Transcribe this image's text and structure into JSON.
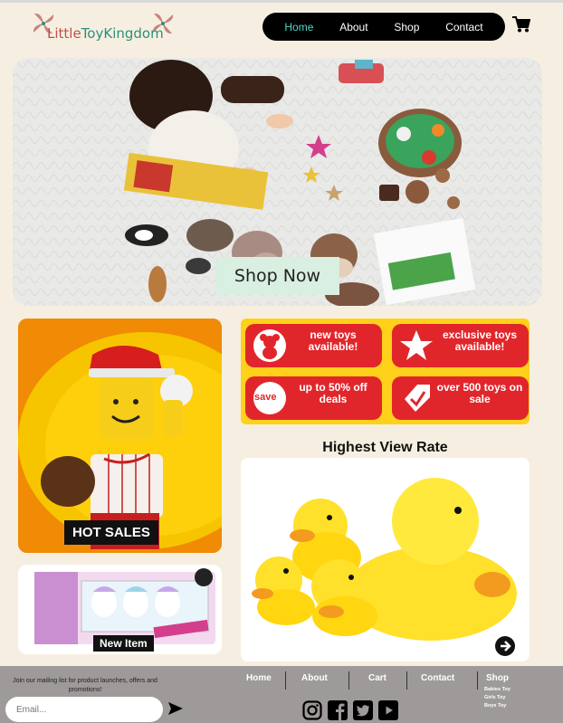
{
  "header": {
    "logo": {
      "part1": "Little",
      "part2": "Toy",
      "part3": "Kingdom"
    },
    "nav": [
      {
        "label": "Home",
        "active": true
      },
      {
        "label": "About",
        "active": false
      },
      {
        "label": "Shop",
        "active": false
      },
      {
        "label": "Contact",
        "active": false
      }
    ],
    "cart_icon": "shopping-cart-icon"
  },
  "hero": {
    "button_label": "Shop Now"
  },
  "hot_sales": {
    "label": "HOT SALES"
  },
  "new_item": {
    "label": "New Item"
  },
  "promo": [
    {
      "text": "new toys available!",
      "icon": "teddy-bear-icon"
    },
    {
      "text": "exclusive toys available!",
      "icon": "star-icon"
    },
    {
      "text": "up to 50% off deals",
      "icon": "save-badge-icon",
      "badge": "save"
    },
    {
      "text": "over 500 toys on sale",
      "icon": "tag-check-icon"
    }
  ],
  "highest_view": {
    "title": "Highest View Rate"
  },
  "footer": {
    "mailing_text": "Join our mailing list for product launches, offers and promotions!",
    "email_placeholder": "Email...",
    "nav": [
      "Home",
      "About",
      "Cart",
      "Contact",
      "Shop"
    ],
    "shop_sub": [
      "Babies Toy",
      "Girls Toy",
      "Boys Toy"
    ],
    "social_icons": [
      "instagram-icon",
      "facebook-icon",
      "twitter-icon",
      "youtube-icon"
    ]
  },
  "colors": {
    "accent": "#52d6c6",
    "promo_red": "#e1262b",
    "promo_yellow": "#ffd11a",
    "hot_orange": "#f18a05"
  }
}
